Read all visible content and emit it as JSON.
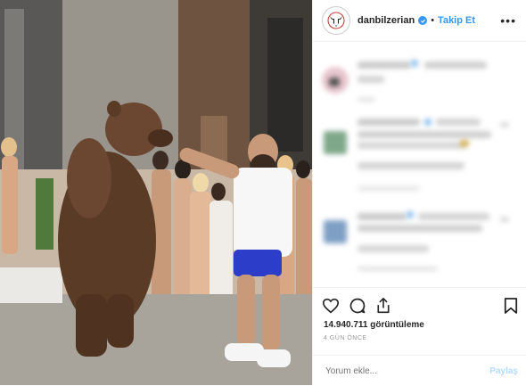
{
  "header": {
    "username": "danbilzerian",
    "follow_label": "Takip Et",
    "separator": "•",
    "more_icon": "ellipsis-icon"
  },
  "actions": {
    "like_icon": "heart-icon",
    "comment_icon": "comment-icon",
    "share_icon": "share-icon",
    "save_icon": "bookmark-icon"
  },
  "stats": {
    "views": "14.940.711 görüntüleme",
    "date": "4 GÜN ÖNCE"
  },
  "comment_box": {
    "placeholder": "Yorum ekle...",
    "submit_label": "Paylaş"
  },
  "colors": {
    "accent": "#3897f0",
    "submit_disabled": "#b3dbff"
  }
}
